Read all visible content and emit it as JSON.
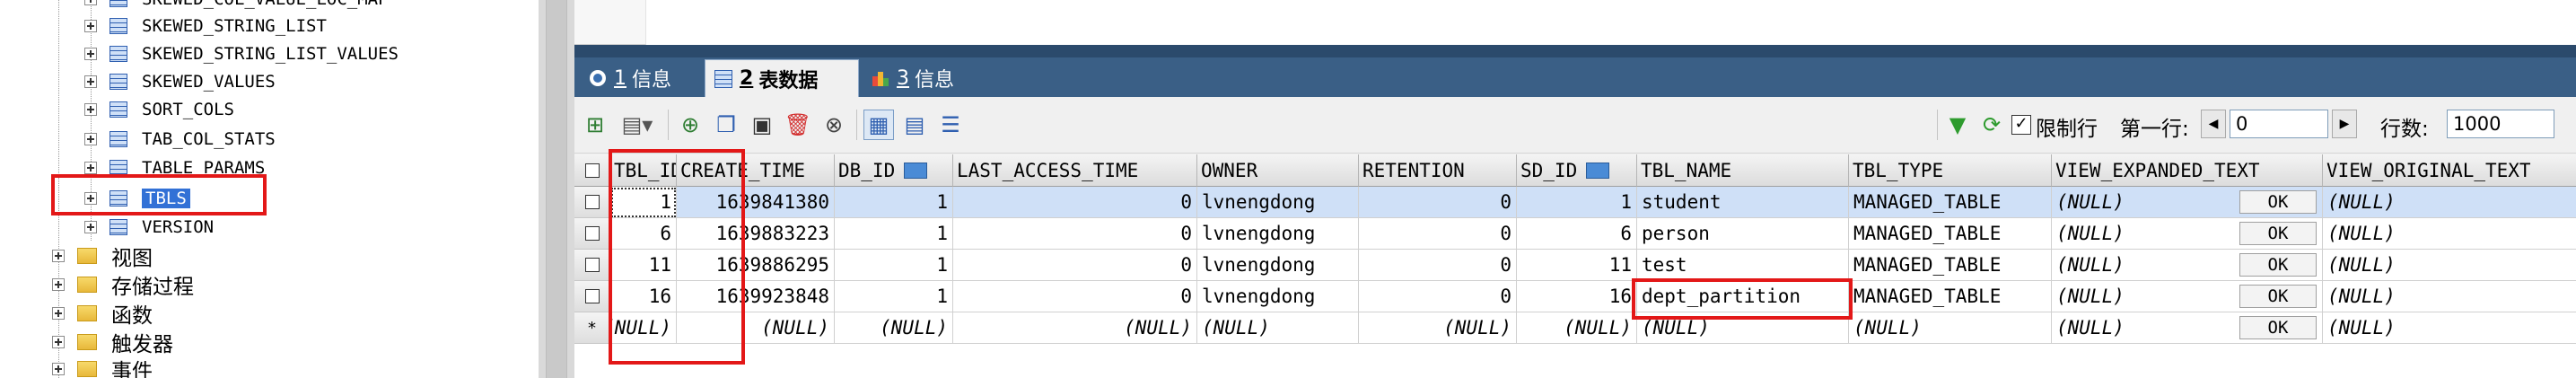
{
  "tree": {
    "partial_top": "SKEWED_COL_VALUE_LOC_MAP",
    "tables": [
      "SKEWED_STRING_LIST",
      "SKEWED_STRING_LIST_VALUES",
      "SKEWED_VALUES",
      "SORT_COLS",
      "TAB_COL_STATS",
      "TABLE_PARAMS",
      "TBLS",
      "VERSION"
    ],
    "selected": "TBLS",
    "folders": [
      "视图",
      "存储过程",
      "函数",
      "触发器",
      "事件"
    ]
  },
  "tabs": [
    {
      "num": "1",
      "label": "信息"
    },
    {
      "num": "2",
      "label": "表数据"
    },
    {
      "num": "3",
      "label": "信息"
    }
  ],
  "toolbar": {
    "limit_label": "限制行",
    "first_row_label": "第一行:",
    "first_row_value": "0",
    "row_count_label": "行数:",
    "row_count_value": "1000"
  },
  "columns": [
    "TBL_ID",
    "CREATE_TIME",
    "DB_ID",
    "LAST_ACCESS_TIME",
    "OWNER",
    "RETENTION",
    "SD_ID",
    "TBL_NAME",
    "TBL_TYPE",
    "VIEW_EXPANDED_TEXT",
    "VIEW_ORIGINAL_TEXT"
  ],
  "rows": [
    {
      "TBL_ID": "1",
      "CREATE_TIME": "1639841380",
      "DB_ID": "1",
      "LAST_ACCESS_TIME": "0",
      "OWNER": "lvnengdong",
      "RETENTION": "0",
      "SD_ID": "1",
      "TBL_NAME": "student",
      "TBL_TYPE": "MANAGED_TABLE",
      "VIEW_EXPANDED_TEXT": "(NULL)",
      "VIEW_ORIGINAL_TEXT": "(NULL)"
    },
    {
      "TBL_ID": "6",
      "CREATE_TIME": "1639883223",
      "DB_ID": "1",
      "LAST_ACCESS_TIME": "0",
      "OWNER": "lvnengdong",
      "RETENTION": "0",
      "SD_ID": "6",
      "TBL_NAME": "person",
      "TBL_TYPE": "MANAGED_TABLE",
      "VIEW_EXPANDED_TEXT": "(NULL)",
      "VIEW_ORIGINAL_TEXT": "(NULL)"
    },
    {
      "TBL_ID": "11",
      "CREATE_TIME": "1639886295",
      "DB_ID": "1",
      "LAST_ACCESS_TIME": "0",
      "OWNER": "lvnengdong",
      "RETENTION": "0",
      "SD_ID": "11",
      "TBL_NAME": "test",
      "TBL_TYPE": "MANAGED_TABLE",
      "VIEW_EXPANDED_TEXT": "(NULL)",
      "VIEW_ORIGINAL_TEXT": "(NULL)"
    },
    {
      "TBL_ID": "16",
      "CREATE_TIME": "1639923848",
      "DB_ID": "1",
      "LAST_ACCESS_TIME": "0",
      "OWNER": "lvnengdong",
      "RETENTION": "0",
      "SD_ID": "16",
      "TBL_NAME": "dept_partition",
      "TBL_TYPE": "MANAGED_TABLE",
      "VIEW_EXPANDED_TEXT": "(NULL)",
      "VIEW_ORIGINAL_TEXT": "(NULL)"
    }
  ],
  "new_row": {
    "marker": "*",
    "value": "(NULL)"
  },
  "ok_label": "OK",
  "colors": {
    "highlight": "#e31818",
    "selection": "#3271d6",
    "tab_bar": "#3a5f86"
  }
}
